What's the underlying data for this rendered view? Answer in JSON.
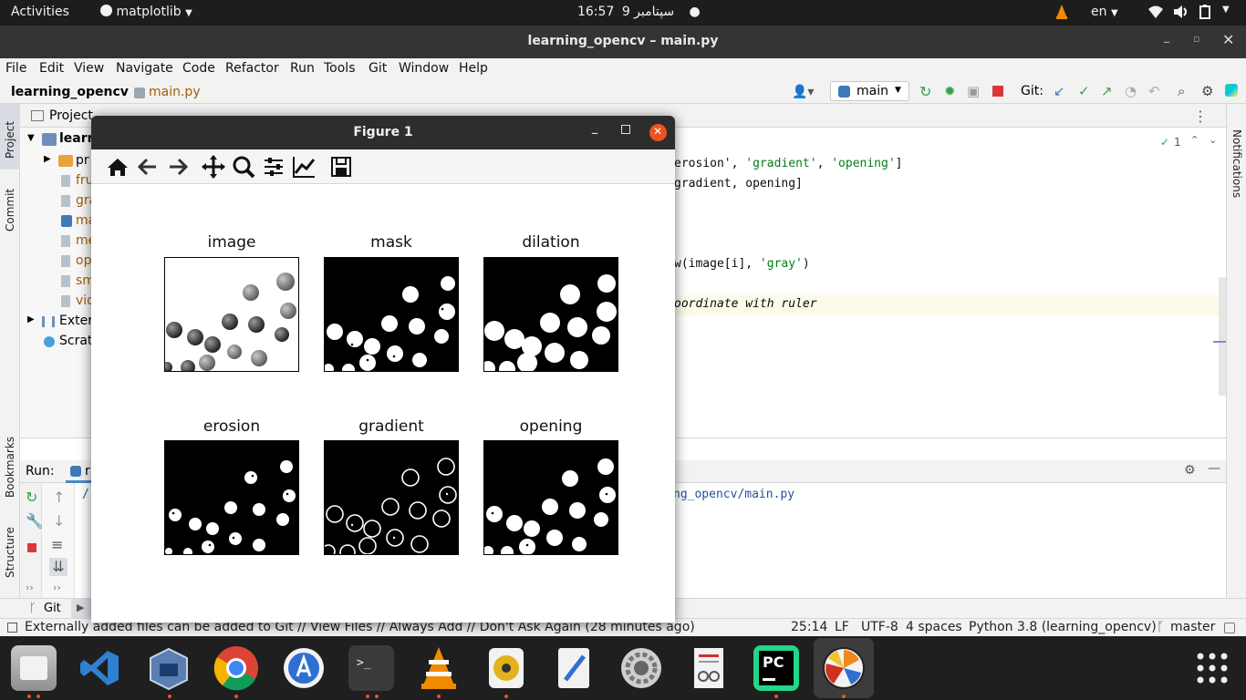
{
  "topbar": {
    "activities": "Activities",
    "app_menu": "matplotlib",
    "clock_time": "16:57",
    "clock_date": "9 سپتامبر",
    "language": "en"
  },
  "window": {
    "title": "learning_opencv – main.py"
  },
  "menu": [
    "File",
    "Edit",
    "View",
    "Navigate",
    "Code",
    "Refactor",
    "Run",
    "Tools",
    "Git",
    "Window",
    "Help"
  ],
  "navbar": {
    "project": "learning_opencv",
    "file": "main.py",
    "run_config": "main",
    "git_label": "Git:"
  },
  "left_stripe": {
    "project": "Project",
    "commit": "Commit",
    "bookmarks": "Bookmarks",
    "structure": "Structure"
  },
  "right_stripe": {
    "notifications": "Notifications"
  },
  "project_pane": {
    "header": "Project",
    "root": "learn",
    "items": [
      "pr",
      "fru",
      "gra",
      "ma",
      "me",
      "op",
      "sm",
      "vio"
    ],
    "external": "Exter",
    "scratches": "Scrat"
  },
  "editor": {
    "inspection_count": "1",
    "line1_a": "erosion', ",
    "line1_b": "'gradient'",
    "line1_c": ", ",
    "line1_d": "'opening'",
    "line1_e": "]",
    "line2": "gradient, opening]",
    "line3_a": "w(image[i], ",
    "line3_b": "'gray'",
    "line3_c": ")",
    "line4": "oordinate with ruler"
  },
  "run_panel": {
    "label": "Run:",
    "tab": "r",
    "output_path": "ng_opencv/main.py",
    "left_text": "/"
  },
  "bottom_tools": {
    "git": "Git"
  },
  "statusbar": {
    "message": "Externally added files can be added to Git // View Files // Always Add // Don't Ask Again (28 minutes ago)",
    "position": "25:14",
    "line_sep": "LF",
    "encoding": "UTF-8",
    "indent": "4 spaces",
    "interpreter": "Python 3.8 (learning_opencv)",
    "branch": "master"
  },
  "figure": {
    "title": "Figure 1",
    "subplots": [
      "image",
      "mask",
      "dilation",
      "erosion",
      "gradient",
      "opening"
    ]
  },
  "dock_apps": [
    "files-icon",
    "visual-studio-code-icon",
    "virtualbox-icon",
    "chrome-icon",
    "app-store-icon",
    "terminal-icon",
    "vlc-icon",
    "rhythmbox-icon",
    "text-editor-icon",
    "settings-icon",
    "document-viewer-icon",
    "pycharm-icon",
    "matplotlib-icon",
    "show-apps-icon"
  ],
  "colors": {
    "accent": "#e95420",
    "string": "#067d17",
    "comment": "#8c8c8c"
  }
}
